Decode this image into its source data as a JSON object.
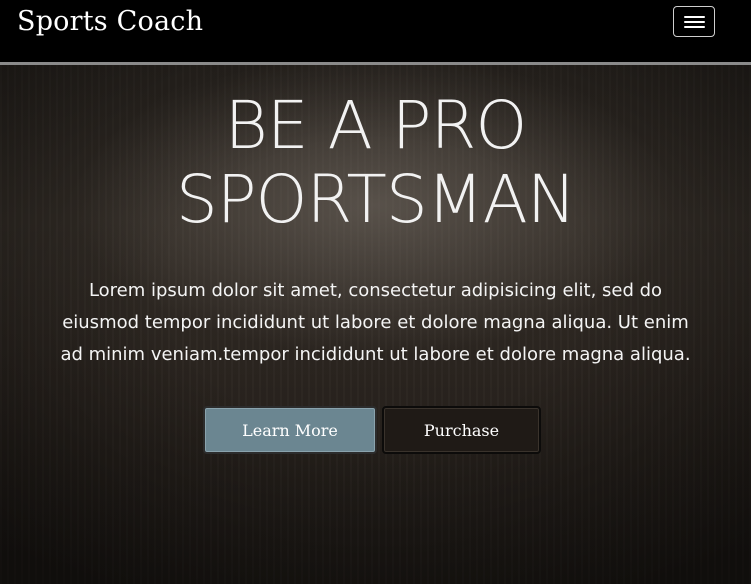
{
  "navbar": {
    "brand": "Sports Coach",
    "toggle_icon": "hamburger-menu-icon"
  },
  "hero": {
    "headline_line1": "BE A PRO",
    "headline_line2": "SPORTSMAN",
    "lead_line1": "Lorem ipsum dolor sit amet, consectetur adipisicing elit, sed do",
    "lead_line2": "eiusmod tempor incididunt ut labore et dolore magna aliqua. Ut enim",
    "lead_line3": "ad minim veniam.tempor incididunt ut labore et dolore magna aliqua.",
    "buttons": {
      "learn_more": "Learn More",
      "purchase": "Purchase"
    }
  },
  "colors": {
    "navbar_bg": "#000000",
    "navbar_border": "#8a8a8a",
    "learn_more_bg": "#6b8691",
    "purchase_bg": "#1f1a16",
    "text": "#ffffff"
  }
}
